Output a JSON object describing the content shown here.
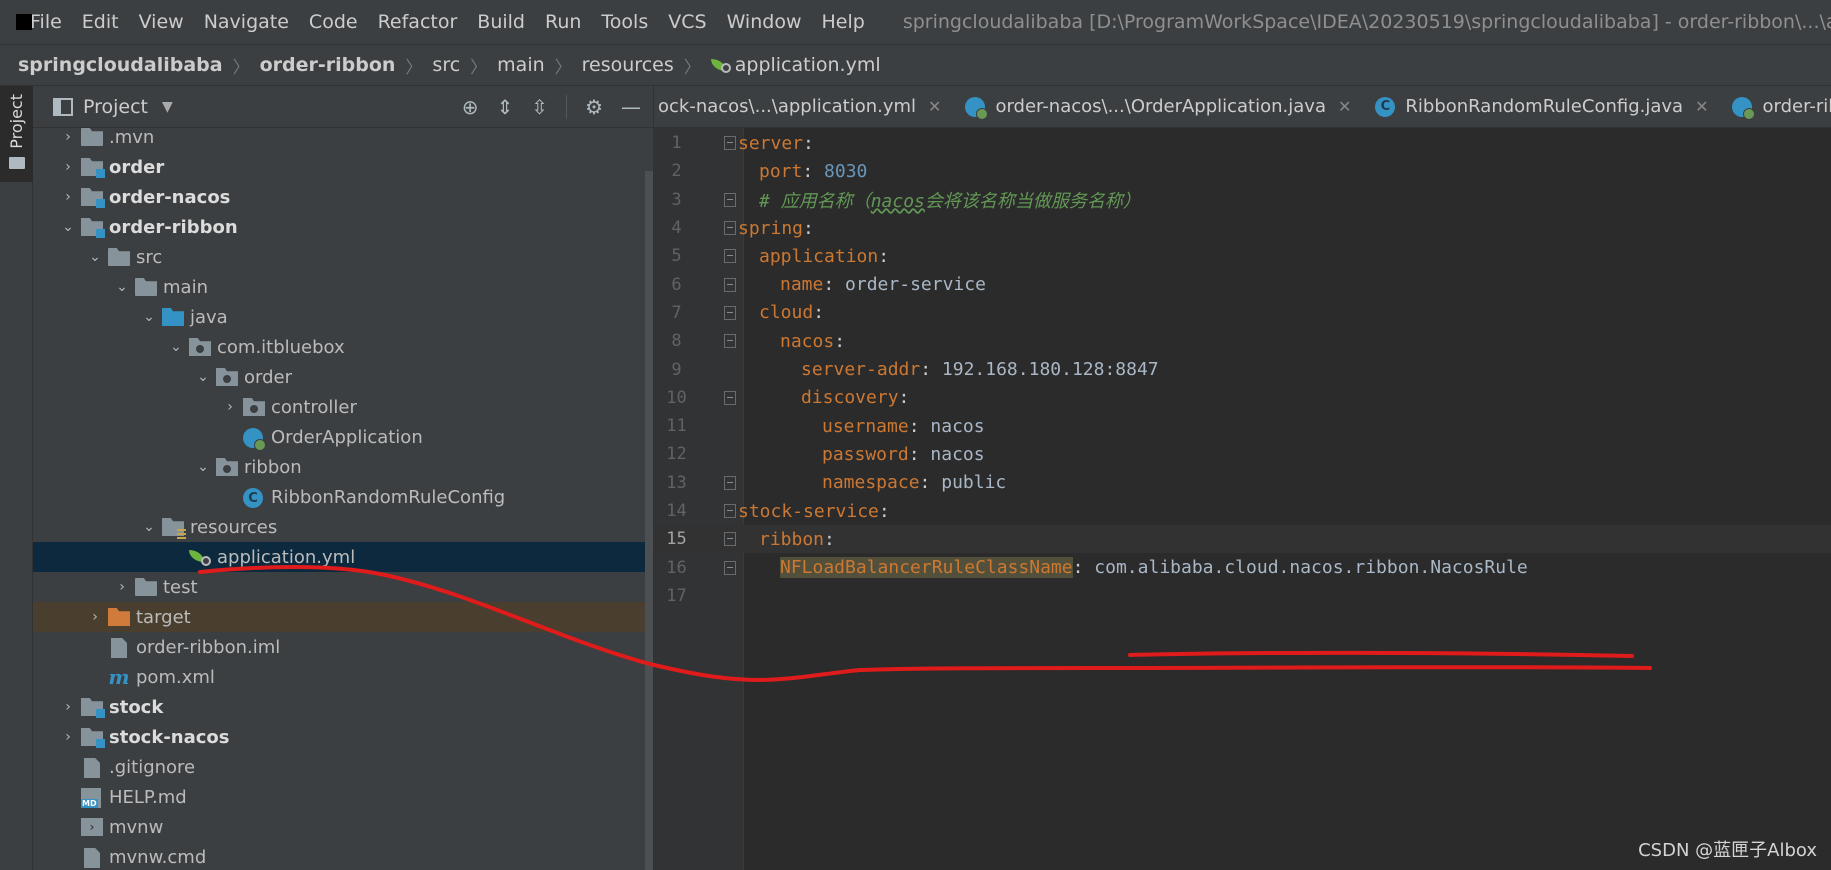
{
  "menubar": {
    "items": [
      "File",
      "Edit",
      "View",
      "Navigate",
      "Code",
      "Refactor",
      "Build",
      "Run",
      "Tools",
      "VCS",
      "Window",
      "Help"
    ],
    "window_title": "springcloudalibaba [D:\\ProgramWorkSpace\\IDEA\\20230519\\springcloudalibaba] - order-ribbon\\...\\application.yml"
  },
  "breadcrumbs": [
    "springcloudalibaba",
    "order-ribbon",
    "src",
    "main",
    "resources",
    "application.yml"
  ],
  "tool_stripe": {
    "project_tab": "Project"
  },
  "project_panel": {
    "title": "Project",
    "tree": [
      {
        "label": ".mvn",
        "depth": 1,
        "arrow": "›",
        "icon": "folder",
        "bold": false
      },
      {
        "label": "order",
        "depth": 1,
        "arrow": "›",
        "icon": "module",
        "bold": true
      },
      {
        "label": "order-nacos",
        "depth": 1,
        "arrow": "›",
        "icon": "module",
        "bold": true
      },
      {
        "label": "order-ribbon",
        "depth": 1,
        "arrow": "⌄",
        "icon": "module",
        "bold": true
      },
      {
        "label": "src",
        "depth": 2,
        "arrow": "⌄",
        "icon": "folder",
        "bold": false
      },
      {
        "label": "main",
        "depth": 3,
        "arrow": "⌄",
        "icon": "folder",
        "bold": false
      },
      {
        "label": "java",
        "depth": 4,
        "arrow": "⌄",
        "icon": "folder-blue",
        "bold": false
      },
      {
        "label": "com.itbluebox",
        "depth": 5,
        "arrow": "⌄",
        "icon": "package",
        "bold": false
      },
      {
        "label": "order",
        "depth": 6,
        "arrow": "⌄",
        "icon": "package",
        "bold": false
      },
      {
        "label": "controller",
        "depth": 7,
        "arrow": "›",
        "icon": "package",
        "bold": false
      },
      {
        "label": "OrderApplication",
        "depth": 7,
        "arrow": "",
        "icon": "spring-app",
        "bold": false
      },
      {
        "label": "ribbon",
        "depth": 6,
        "arrow": "⌄",
        "icon": "package",
        "bold": false
      },
      {
        "label": "RibbonRandomRuleConfig",
        "depth": 7,
        "arrow": "",
        "icon": "class",
        "bold": false
      },
      {
        "label": "resources",
        "depth": 4,
        "arrow": "⌄",
        "icon": "resources",
        "bold": false
      },
      {
        "label": "application.yml",
        "depth": 5,
        "arrow": "",
        "icon": "yml",
        "bold": false,
        "selected": true
      },
      {
        "label": "test",
        "depth": 3,
        "arrow": "›",
        "icon": "folder",
        "bold": false
      },
      {
        "label": "target",
        "depth": 2,
        "arrow": "›",
        "icon": "folder-orange",
        "bold": false,
        "excluded": true
      },
      {
        "label": "order-ribbon.iml",
        "depth": 2,
        "arrow": "",
        "icon": "file",
        "bold": false
      },
      {
        "label": "pom.xml",
        "depth": 2,
        "arrow": "",
        "icon": "maven",
        "bold": false
      },
      {
        "label": "stock",
        "depth": 1,
        "arrow": "›",
        "icon": "module",
        "bold": true
      },
      {
        "label": "stock-nacos",
        "depth": 1,
        "arrow": "›",
        "icon": "module",
        "bold": true
      },
      {
        "label": ".gitignore",
        "depth": 1,
        "arrow": "",
        "icon": "file",
        "bold": false
      },
      {
        "label": "HELP.md",
        "depth": 1,
        "arrow": "",
        "icon": "md",
        "bold": false
      },
      {
        "label": "mvnw",
        "depth": 1,
        "arrow": "",
        "icon": "terminal",
        "bold": false
      },
      {
        "label": "mvnw.cmd",
        "depth": 1,
        "arrow": "",
        "icon": "file",
        "bold": false
      }
    ]
  },
  "editor": {
    "tabs": [
      {
        "label": "ock-nacos\\...\\application.yml",
        "icon": "yml"
      },
      {
        "label": "order-nacos\\...\\OrderApplication.java",
        "icon": "spring-app"
      },
      {
        "label": "RibbonRandomRuleConfig.java",
        "icon": "class"
      },
      {
        "label": "order-ribbon",
        "icon": "spring-app"
      }
    ],
    "current_line": 15,
    "lines": [
      {
        "num": "1",
        "indent": 0,
        "tokens": [
          {
            "t": "server",
            "c": "k"
          },
          {
            "t": ":",
            "c": "p"
          }
        ],
        "fold": true
      },
      {
        "num": "2",
        "indent": 1,
        "tokens": [
          {
            "t": "port",
            "c": "k"
          },
          {
            "t": ": ",
            "c": "p"
          },
          {
            "t": "8030",
            "c": "n"
          }
        ],
        "fold": false
      },
      {
        "num": "3",
        "indent": 1,
        "tokens": [
          {
            "t": "# 应用名称（",
            "c": "c"
          },
          {
            "t": "nacos",
            "c": "cu"
          },
          {
            "t": "会将该名称当做服务名称）",
            "c": "c"
          }
        ],
        "fold": true
      },
      {
        "num": "4",
        "indent": 0,
        "tokens": [
          {
            "t": "spring",
            "c": "k"
          },
          {
            "t": ":",
            "c": "p"
          }
        ],
        "fold": true
      },
      {
        "num": "5",
        "indent": 1,
        "tokens": [
          {
            "t": "application",
            "c": "k"
          },
          {
            "t": ":",
            "c": "p"
          }
        ],
        "fold": true
      },
      {
        "num": "6",
        "indent": 2,
        "tokens": [
          {
            "t": "name",
            "c": "k"
          },
          {
            "t": ": ",
            "c": "p"
          },
          {
            "t": "order-service",
            "c": "v"
          }
        ],
        "fold": true
      },
      {
        "num": "7",
        "indent": 1,
        "tokens": [
          {
            "t": "cloud",
            "c": "k"
          },
          {
            "t": ":",
            "c": "p"
          }
        ],
        "fold": true
      },
      {
        "num": "8",
        "indent": 2,
        "tokens": [
          {
            "t": "nacos",
            "c": "k"
          },
          {
            "t": ":",
            "c": "p"
          }
        ],
        "fold": true
      },
      {
        "num": "9",
        "indent": 3,
        "tokens": [
          {
            "t": "server-addr",
            "c": "k"
          },
          {
            "t": ": ",
            "c": "p"
          },
          {
            "t": "192.168.180.128:8847",
            "c": "v"
          }
        ],
        "fold": false
      },
      {
        "num": "10",
        "indent": 3,
        "tokens": [
          {
            "t": "discovery",
            "c": "k"
          },
          {
            "t": ":",
            "c": "p"
          }
        ],
        "fold": true
      },
      {
        "num": "11",
        "indent": 4,
        "tokens": [
          {
            "t": "username",
            "c": "k"
          },
          {
            "t": ": ",
            "c": "p"
          },
          {
            "t": "nacos",
            "c": "v"
          }
        ],
        "fold": false
      },
      {
        "num": "12",
        "indent": 4,
        "tokens": [
          {
            "t": "password",
            "c": "k"
          },
          {
            "t": ": ",
            "c": "p"
          },
          {
            "t": "nacos",
            "c": "v"
          }
        ],
        "fold": false
      },
      {
        "num": "13",
        "indent": 4,
        "tokens": [
          {
            "t": "namespace",
            "c": "k"
          },
          {
            "t": ": ",
            "c": "p"
          },
          {
            "t": "public",
            "c": "v"
          }
        ],
        "fold": true
      },
      {
        "num": "14",
        "indent": 0,
        "tokens": [
          {
            "t": "stock-service",
            "c": "k"
          },
          {
            "t": ":",
            "c": "p"
          }
        ],
        "fold": true
      },
      {
        "num": "15",
        "indent": 1,
        "tokens": [
          {
            "t": "ribbon",
            "c": "k"
          },
          {
            "t": ":",
            "c": "p"
          }
        ],
        "fold": true
      },
      {
        "num": "16",
        "indent": 2,
        "tokens": [
          {
            "t": "NFLoadBalancerRuleClassName",
            "c": "kh"
          },
          {
            "t": ": ",
            "c": "p"
          },
          {
            "t": "com.alibaba.cloud.nacos.ribbon.NacosRule",
            "c": "v"
          }
        ],
        "fold": true
      },
      {
        "num": "17",
        "indent": 0,
        "tokens": [],
        "fold": false
      }
    ]
  },
  "watermark": "CSDN @蓝匣子Albox",
  "colors": {
    "annotation_red": "#e01b1b",
    "selection": "#0d293e",
    "yaml_key": "#cc7832"
  }
}
